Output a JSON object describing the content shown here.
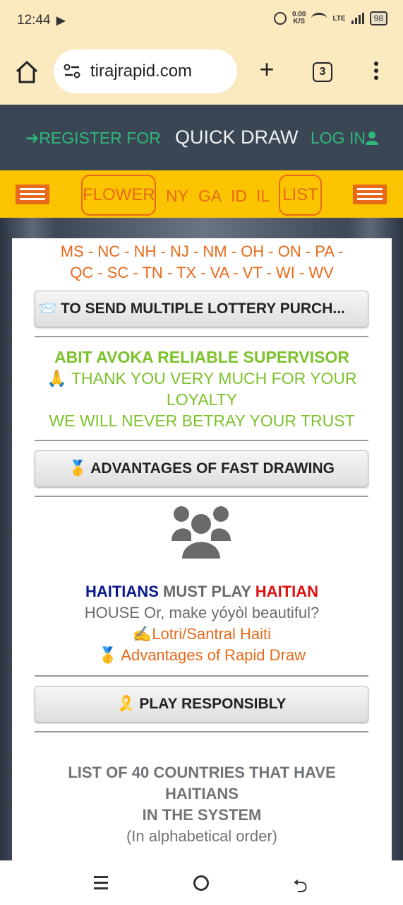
{
  "status": {
    "time": "12:44",
    "net_speed_value": "0.00",
    "net_speed_unit": "K/S",
    "network": "LTE",
    "battery": "98"
  },
  "browser": {
    "url": "tirajrapid.com",
    "tab_count": "3",
    "new_tab_glyph": "+"
  },
  "header": {
    "register_label": "REGISTER FOR",
    "title": "QUICK DRAW",
    "login_label": "LOG IN"
  },
  "nav": {
    "flower": "FLOWER",
    "ny": "NY",
    "ga": "GA",
    "id": "ID",
    "il": "IL",
    "list": "LIST"
  },
  "content": {
    "states_line_1": "MS - NC - NH - NJ - NM - OH - ON - PA -",
    "states_line_2": "QC - SC - TN - TX - VA - VT - WI - WV",
    "send_button": "📨 TO SEND MULTIPLE LOTTERY PURCH...",
    "supervisor_title": "ABIT AVOKA RELIABLE SUPERVISOR",
    "thanks_line_1": "🙏 THANK YOU VERY MUCH FOR YOUR",
    "thanks_line_2": "LOYALTY",
    "trust_line": "WE WILL NEVER BETRAY YOUR TRUST",
    "advantages_button": "🥇 ADVANTAGES OF FAST DRAWING",
    "haitians_word": "HAITIANS",
    "must_play": " MUST PLAY ",
    "haitian_word": "HAITIAN",
    "house_line": "HOUSE Or, make yóyòl beautiful?",
    "lotri_link": "✍️Lotri/Santral Haiti",
    "advantages_link": "🥇 Advantages of Rapid Draw",
    "play_button": "🎗️ PLAY RESPONSIBLY",
    "list_heading_1": "LIST OF 40 COUNTRIES THAT HAVE",
    "list_heading_2": "HAITIANS",
    "list_heading_3": "IN THE SYSTEM",
    "list_sub": "(In alphabetical order)"
  },
  "colors": {
    "header_bg": "#3b4654",
    "nav_bg": "#fbc400",
    "accent_orange": "#e8691a",
    "accent_green": "#2eb87a",
    "lime_green": "#7cc22c",
    "haitians_blue": "#0a1a8a",
    "haitian_red": "#e01010"
  },
  "icons": {
    "home": "home-icon",
    "url_settings": "tune-icon",
    "register": "sign-in-icon",
    "login": "user-icon",
    "people": "users-icon",
    "back": "back-icon"
  }
}
